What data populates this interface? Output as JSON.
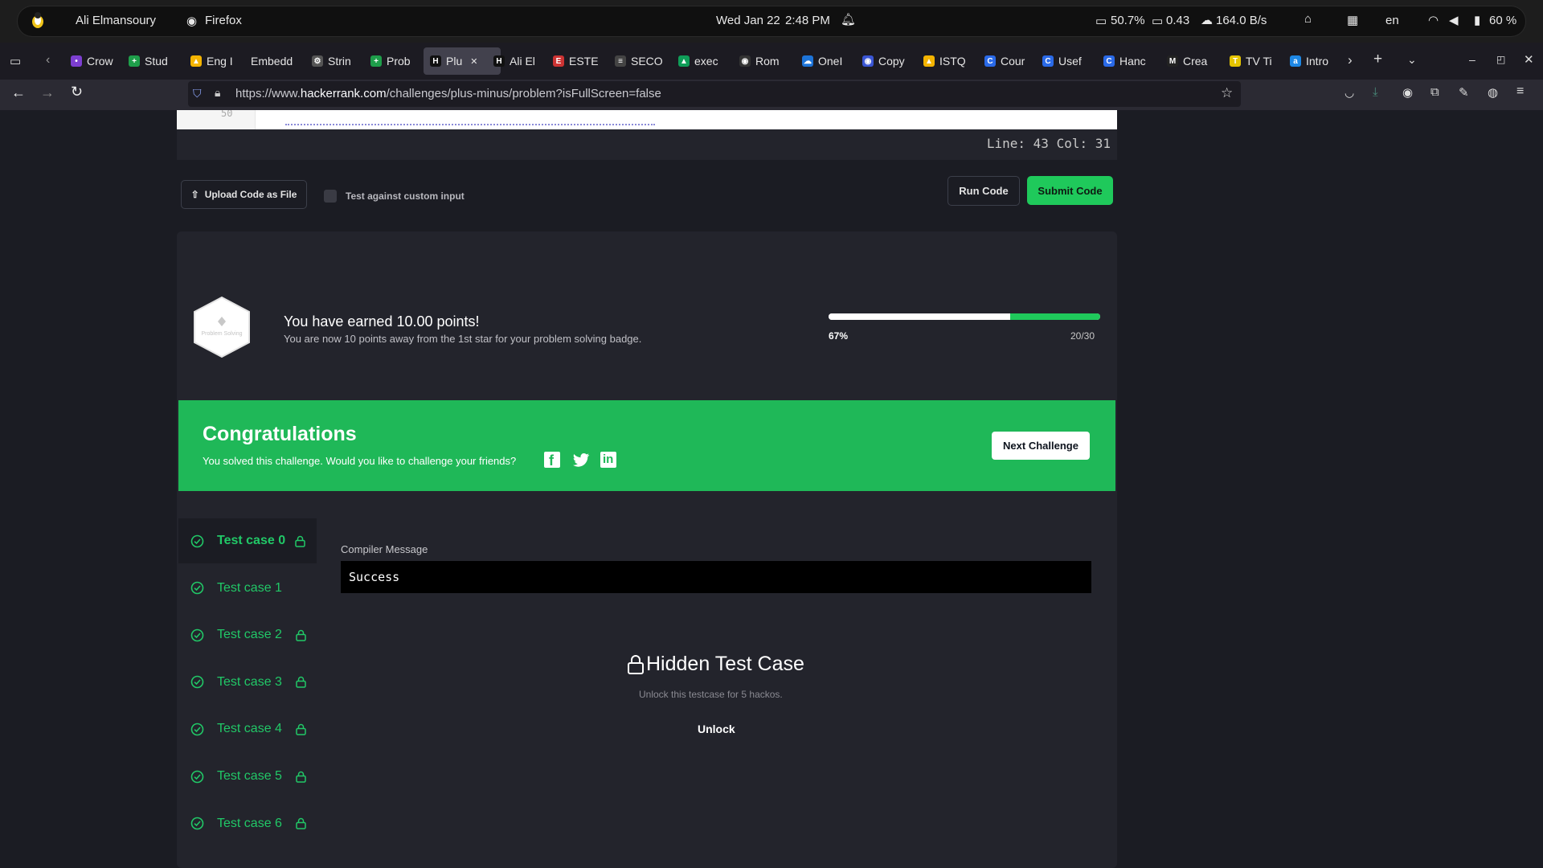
{
  "system_bar": {
    "user": "Ali Elmansoury",
    "app": "Firefox",
    "date": "Wed Jan 22",
    "time": "2:48 PM",
    "cpu": "50.7%",
    "load": "0.43",
    "net": "164.0 B/s",
    "lang": "en",
    "battery": "60 %"
  },
  "tabs": [
    {
      "label": "Crow",
      "color": "#7d3fd1",
      "glyph": "•"
    },
    {
      "label": "Stud",
      "color": "#1e9e4a",
      "glyph": "+"
    },
    {
      "label": "Eng I",
      "color": "#f4b400",
      "glyph": "▲"
    },
    {
      "label": "Embedd",
      "color": "",
      "glyph": ""
    },
    {
      "label": "Strin",
      "color": "#555",
      "glyph": "⚙"
    },
    {
      "label": "Prob",
      "color": "#1e9e4a",
      "glyph": "+"
    },
    {
      "label": "Plu",
      "color": "#111",
      "glyph": "H",
      "active": true
    },
    {
      "label": "Ali El",
      "color": "#111",
      "glyph": "H"
    },
    {
      "label": "ESTE",
      "color": "#c33",
      "glyph": "E"
    },
    {
      "label": "SECO",
      "color": "#444",
      "glyph": "≡"
    },
    {
      "label": "exec",
      "color": "#0f9d58",
      "glyph": "▲"
    },
    {
      "label": "Rom",
      "color": "#333",
      "glyph": "◉"
    },
    {
      "label": "OneI",
      "color": "#1d74d8",
      "glyph": "☁"
    },
    {
      "label": "Copy",
      "color": "#3a56d4",
      "glyph": "◉"
    },
    {
      "label": "ISTQ",
      "color": "#f4b400",
      "glyph": "▲"
    },
    {
      "label": "Cour",
      "color": "#2a6ae8",
      "glyph": "C"
    },
    {
      "label": "Usef",
      "color": "#2a6ae8",
      "glyph": "C"
    },
    {
      "label": "Hanc",
      "color": "#2a6ae8",
      "glyph": "C"
    },
    {
      "label": "Crea",
      "color": "#222",
      "glyph": "M"
    },
    {
      "label": "TV Ti",
      "color": "#e5c400",
      "glyph": "T"
    },
    {
      "label": "Intro",
      "color": "#1e88e5",
      "glyph": "a"
    }
  ],
  "url": {
    "prefix": "https://www.",
    "domain": "hackerrank.com",
    "path": "/challenges/plus-minus/problem?isFullScreen=false"
  },
  "editor": {
    "line_number": "50",
    "status": "Line: 43 Col: 31"
  },
  "actions": {
    "upload_label": "Upload Code as File",
    "custom_input_label": "Test against custom input",
    "run_label": "Run Code",
    "submit_label": "Submit Code"
  },
  "points": {
    "badge_label": "Problem Solving",
    "title": "You have earned 10.00 points!",
    "subtitle": "You are now 10 points away from the 1st star for your problem solving badge.",
    "percent_label": "67%",
    "progress_fraction": 0.67,
    "score_label": "20/30"
  },
  "banner": {
    "title": "Congratulations",
    "text": "You solved this challenge. Would you like to challenge your friends?",
    "next_label": "Next Challenge"
  },
  "test_cases": [
    {
      "label": "Test case 0",
      "locked": true,
      "active": true
    },
    {
      "label": "Test case 1",
      "locked": false
    },
    {
      "label": "Test case 2",
      "locked": true
    },
    {
      "label": "Test case 3",
      "locked": true
    },
    {
      "label": "Test case 4",
      "locked": true
    },
    {
      "label": "Test case 5",
      "locked": true
    },
    {
      "label": "Test case 6",
      "locked": true
    }
  ],
  "result": {
    "compiler_label": "Compiler Message",
    "compiler_value": "Success",
    "hidden_title": "Hidden Test Case",
    "hidden_text": "Unlock this testcase for 5 hackos.",
    "unlock_label": "Unlock"
  },
  "colors": {
    "accent_green": "#1fb858",
    "text_green": "#21c867"
  }
}
